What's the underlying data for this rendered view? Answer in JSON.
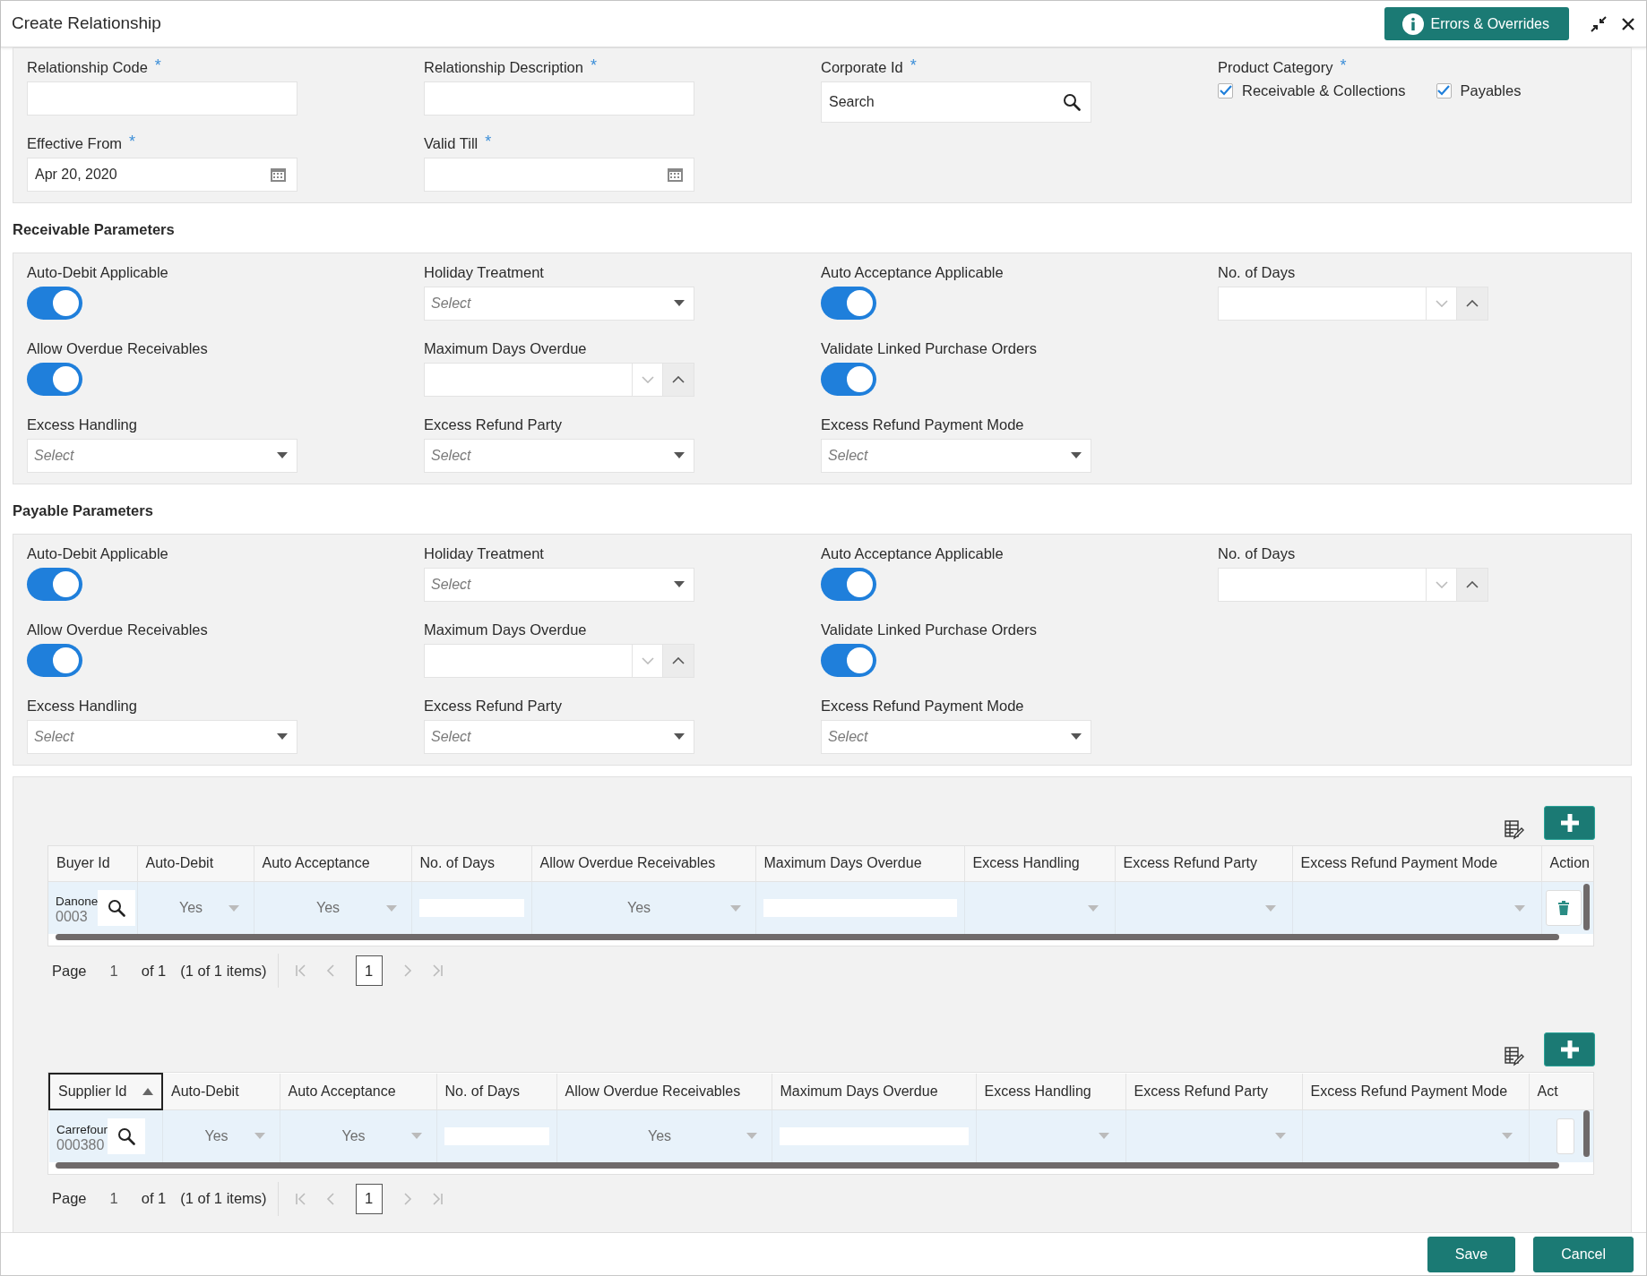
{
  "window": {
    "title": "Create Relationship",
    "errors_button": "Errors & Overrides"
  },
  "main_panel": {
    "rows": [
      [
        {
          "kind": "text",
          "label": "Relationship Code",
          "required_mark": "*"
        },
        {
          "kind": "text",
          "label": "Relationship Description",
          "required_mark": "*"
        },
        {
          "kind": "search",
          "label": "Corporate Id",
          "required_mark": "*",
          "placeholder": "Search"
        },
        {
          "kind": "checkboxes",
          "label": "Product Category",
          "required_mark": "*",
          "options": [
            {
              "label": "Receivable & Collections",
              "checked": true
            },
            {
              "label": "Payables",
              "checked": true
            }
          ]
        }
      ],
      [
        {
          "kind": "date",
          "label": "Effective From",
          "required_mark": "*",
          "value": "Apr 20, 2020"
        },
        {
          "kind": "date",
          "label": "Valid Till",
          "required_mark": "*"
        }
      ]
    ]
  },
  "sections": [
    {
      "title": "Receivable Parameters",
      "rows": [
        [
          {
            "kind": "toggle",
            "label": "Auto-Debit Applicable",
            "on": true
          },
          {
            "kind": "select",
            "label": "Holiday Treatment",
            "placeholder": "Select"
          },
          {
            "kind": "toggle",
            "label": "Auto Acceptance Applicable",
            "on": true
          },
          {
            "kind": "stepper",
            "label": "No. of Days"
          }
        ],
        [
          {
            "kind": "toggle",
            "label": "Allow Overdue Receivables",
            "on": true
          },
          {
            "kind": "stepper",
            "label": "Maximum Days Overdue"
          },
          {
            "kind": "toggle",
            "label": "Validate Linked Purchase Orders",
            "on": true
          }
        ],
        [
          {
            "kind": "select",
            "label": "Excess Handling",
            "placeholder": "Select"
          },
          {
            "kind": "select",
            "label": "Excess Refund Party",
            "placeholder": "Select"
          },
          {
            "kind": "select",
            "label": "Excess Refund Payment Mode",
            "placeholder": "Select"
          }
        ]
      ]
    },
    {
      "title": "Payable Parameters",
      "rows": [
        [
          {
            "kind": "toggle",
            "label": "Auto-Debit Applicable",
            "on": true
          },
          {
            "kind": "select",
            "label": "Holiday Treatment",
            "placeholder": "Select"
          },
          {
            "kind": "toggle",
            "label": "Auto Acceptance Applicable",
            "on": true
          },
          {
            "kind": "stepper",
            "label": "No. of Days"
          }
        ],
        [
          {
            "kind": "toggle",
            "label": "Allow Overdue Receivables",
            "on": true
          },
          {
            "kind": "stepper",
            "label": "Maximum Days Overdue"
          },
          {
            "kind": "toggle",
            "label": "Validate Linked Purchase Orders",
            "on": true
          }
        ],
        [
          {
            "kind": "select",
            "label": "Excess Handling",
            "placeholder": "Select"
          },
          {
            "kind": "select",
            "label": "Excess Refund Party",
            "placeholder": "Select"
          },
          {
            "kind": "select",
            "label": "Excess Refund Payment Mode",
            "placeholder": "Select"
          }
        ]
      ]
    }
  ],
  "grids": [
    {
      "columns": [
        {
          "label": "Buyer Id",
          "sorted": false
        },
        {
          "label": "Auto-Debit",
          "sorted": false
        },
        {
          "label": "Auto Acceptance",
          "sorted": false
        },
        {
          "label": "No. of Days",
          "sorted": false
        },
        {
          "label": "Allow Overdue Receivables",
          "sorted": false
        },
        {
          "label": "Maximum Days Overdue",
          "sorted": false
        },
        {
          "label": "Excess Handling",
          "sorted": false
        },
        {
          "label": "Excess Refund Party",
          "sorted": false
        },
        {
          "label": "Excess Refund Payment Mode",
          "sorted": false
        },
        {
          "label": "Action",
          "sorted": false
        }
      ],
      "rows": [
        {
          "cells": [
            {
              "kind": "lookup",
              "name": "Danone",
              "value": "0003"
            },
            {
              "kind": "select",
              "value": "Yes"
            },
            {
              "kind": "select",
              "value": "Yes"
            },
            {
              "kind": "input"
            },
            {
              "kind": "select",
              "value": "Yes"
            },
            {
              "kind": "input"
            },
            {
              "kind": "select"
            },
            {
              "kind": "select"
            },
            {
              "kind": "select"
            },
            {
              "kind": "action"
            }
          ]
        }
      ],
      "pager": {
        "label": "Page",
        "page": "1",
        "of": "of 1",
        "items": "(1 of 1 items)",
        "current": "1"
      }
    },
    {
      "columns": [
        {
          "label": "Supplier Id",
          "sorted": true
        },
        {
          "label": "Auto-Debit",
          "sorted": false
        },
        {
          "label": "Auto Acceptance",
          "sorted": false
        },
        {
          "label": "No. of Days",
          "sorted": false
        },
        {
          "label": "Allow Overdue Receivables",
          "sorted": false
        },
        {
          "label": "Maximum Days Overdue",
          "sorted": false
        },
        {
          "label": "Excess Handling",
          "sorted": false
        },
        {
          "label": "Excess Refund Party",
          "sorted": false
        },
        {
          "label": "Excess Refund Payment Mode",
          "sorted": false
        },
        {
          "label": "Act",
          "sorted": false
        }
      ],
      "rows": [
        {
          "cells": [
            {
              "kind": "lookup",
              "name": "Carrefour",
              "value": "000380"
            },
            {
              "kind": "select",
              "value": "Yes"
            },
            {
              "kind": "select",
              "value": "Yes"
            },
            {
              "kind": "input"
            },
            {
              "kind": "select",
              "value": "Yes"
            },
            {
              "kind": "input"
            },
            {
              "kind": "select"
            },
            {
              "kind": "select"
            },
            {
              "kind": "select"
            },
            {
              "kind": "action-edge"
            }
          ]
        }
      ],
      "pager": {
        "label": "Page",
        "page": "1",
        "of": "of 1",
        "items": "(1 of 1 items)",
        "current": "1"
      }
    }
  ],
  "footer": {
    "buttons": [
      "Save",
      "Cancel"
    ]
  }
}
